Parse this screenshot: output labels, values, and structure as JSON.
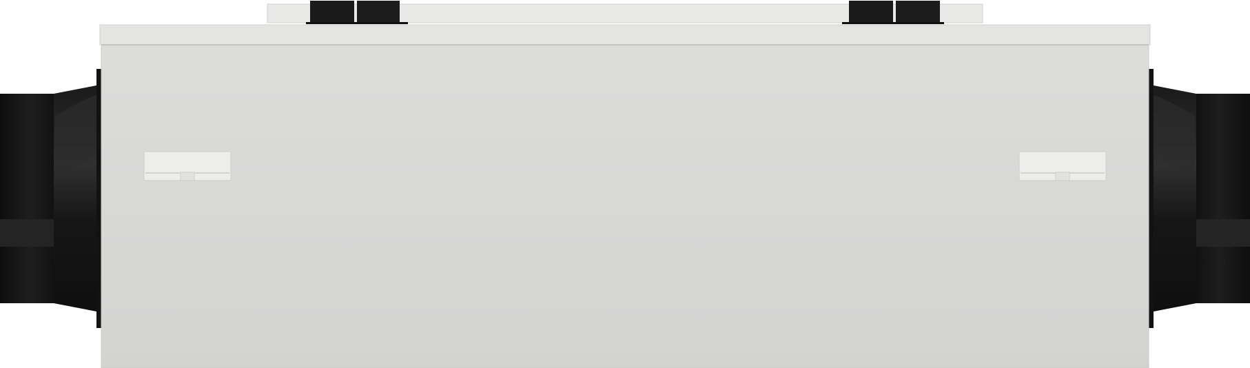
{
  "scene": {
    "subject": "ventilation-unit-product-render",
    "colors": {
      "background": "#ffffff",
      "housing_body": "#d6d6d5",
      "housing_body_highlight": "#dcdcdb",
      "housing_lid": "#e4e4e3",
      "housing_lid_edge": "#cfcfce",
      "back_flange": "#e9e9e8",
      "latch": "#ededec",
      "duct_collar_dark": "#151515",
      "duct_collar_mid": "#2a2a2a",
      "duct_collar_ring": "#1c1c1c",
      "mount_bracket": "#1a1a1a"
    }
  }
}
